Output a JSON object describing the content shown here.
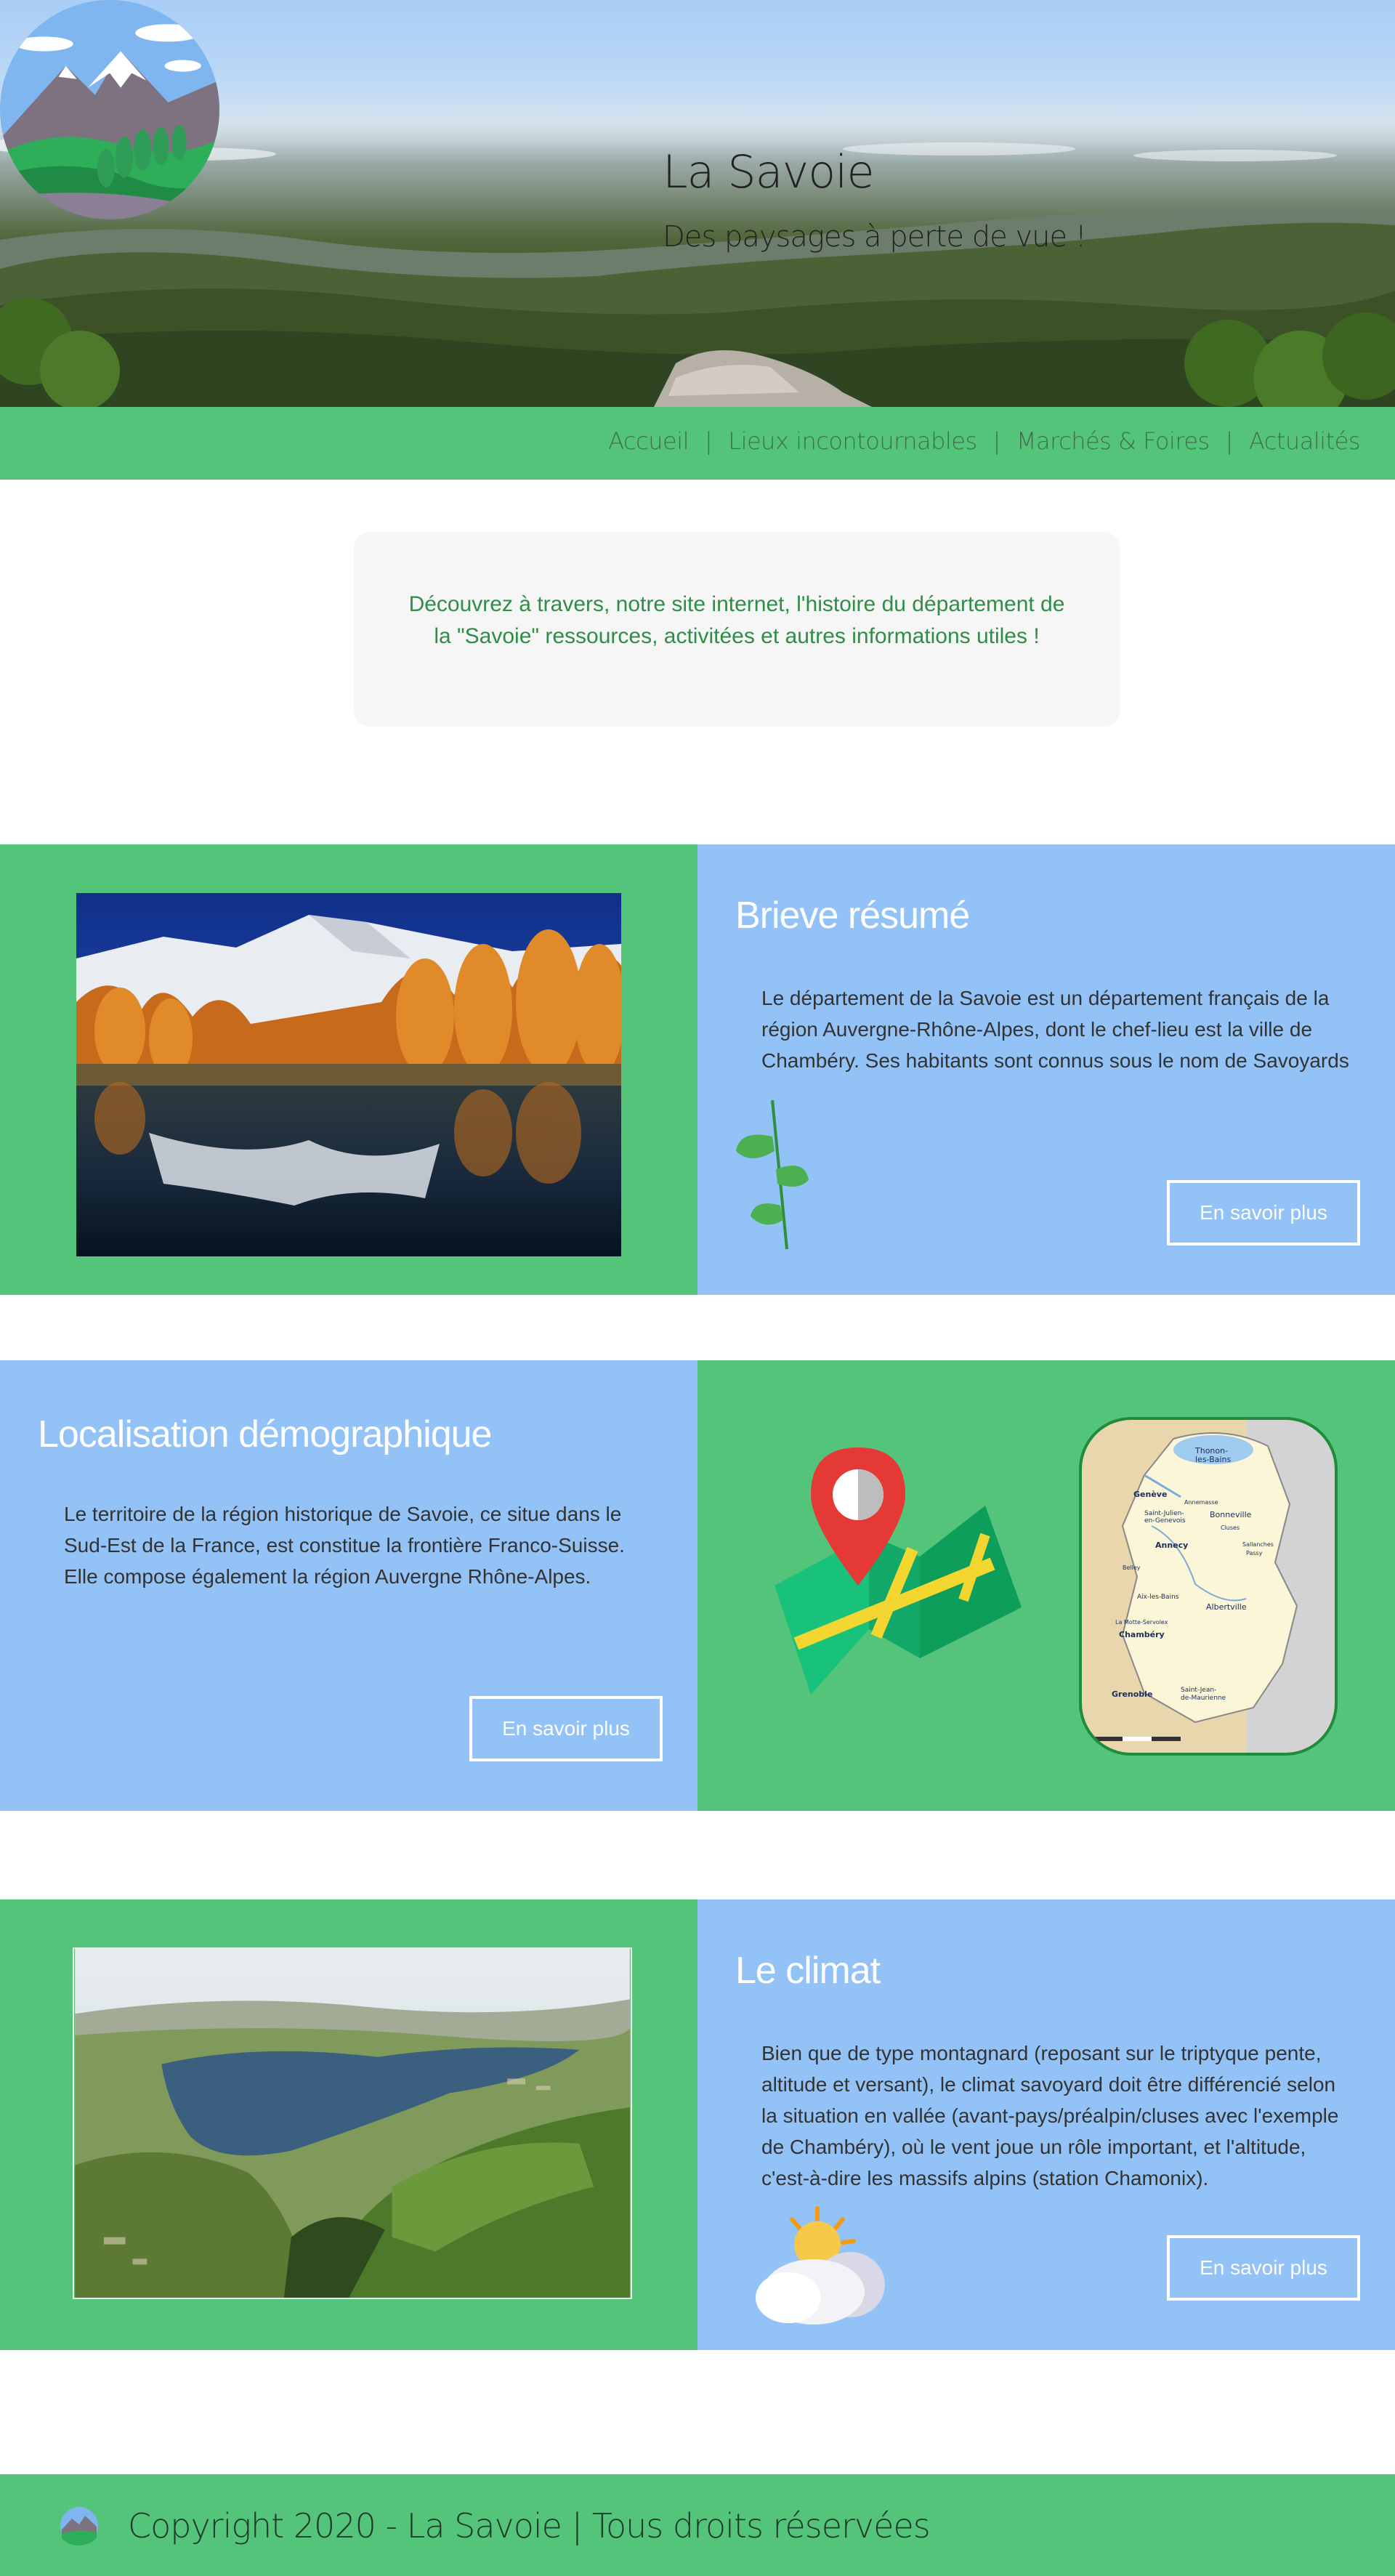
{
  "header": {
    "title": "La Savoie",
    "subtitle": "Des paysages à perte de vue !"
  },
  "nav": {
    "items": [
      "Accueil",
      "Lieux incontournables",
      "Marchés & Foires",
      "Actualités"
    ],
    "separator": "|"
  },
  "intro": {
    "text": "Découvrez à travers, notre site internet, l'histoire du département de la \"Savoie\" ressources, activitées et autres informations utiles !"
  },
  "sections": [
    {
      "title": "Brieve résumé",
      "text": "Le département de la Savoie est un département français de la région Auvergne-Rhône-Alpes, dont le chef-lieu est la ville de Chambéry. Ses habitants sont connus sous le nom de Savoyards",
      "button": "En savoir plus"
    },
    {
      "title": "Localisation démographique",
      "text": "Le territoire de la région historique de Savoie, ce situe dans le Sud-Est de la France, est constitue la frontière Franco-Suisse. Elle compose également la région Auvergne Rhône-Alpes.",
      "button": "En savoir plus"
    },
    {
      "title": "Le climat",
      "text": "Bien que de type montagnard (reposant sur le triptyque pente, altitude et versant), le climat savoyard doit être différencié selon la situation en vallée (avant-pays/préalpin/cluses avec l'exemple de Chambéry), où le vent joue un rôle important, et l'altitude, c'est-à-dire les massifs alpins (station Chamonix).",
      "button": "En savoir plus"
    }
  ],
  "map_labels": [
    "Genève",
    "Thonon-les-Bains",
    "Annemasse",
    "Saint-Julien-en-Genevois",
    "Bonneville",
    "Cluses",
    "Sallanches",
    "Passy",
    "Annecy",
    "Aix-les-Bains",
    "Albertville",
    "Chambéry",
    "La Motte-Servolex",
    "Grenoble",
    "Saint-Jean-de-Maurienne",
    "Belley"
  ],
  "footer": {
    "copyright": "Copyright 2020 - La Savoie | Tous droits réservées"
  },
  "colors": {
    "green": "#55c47b",
    "blue": "#93c2f6",
    "intro_text": "#2e8d46"
  }
}
